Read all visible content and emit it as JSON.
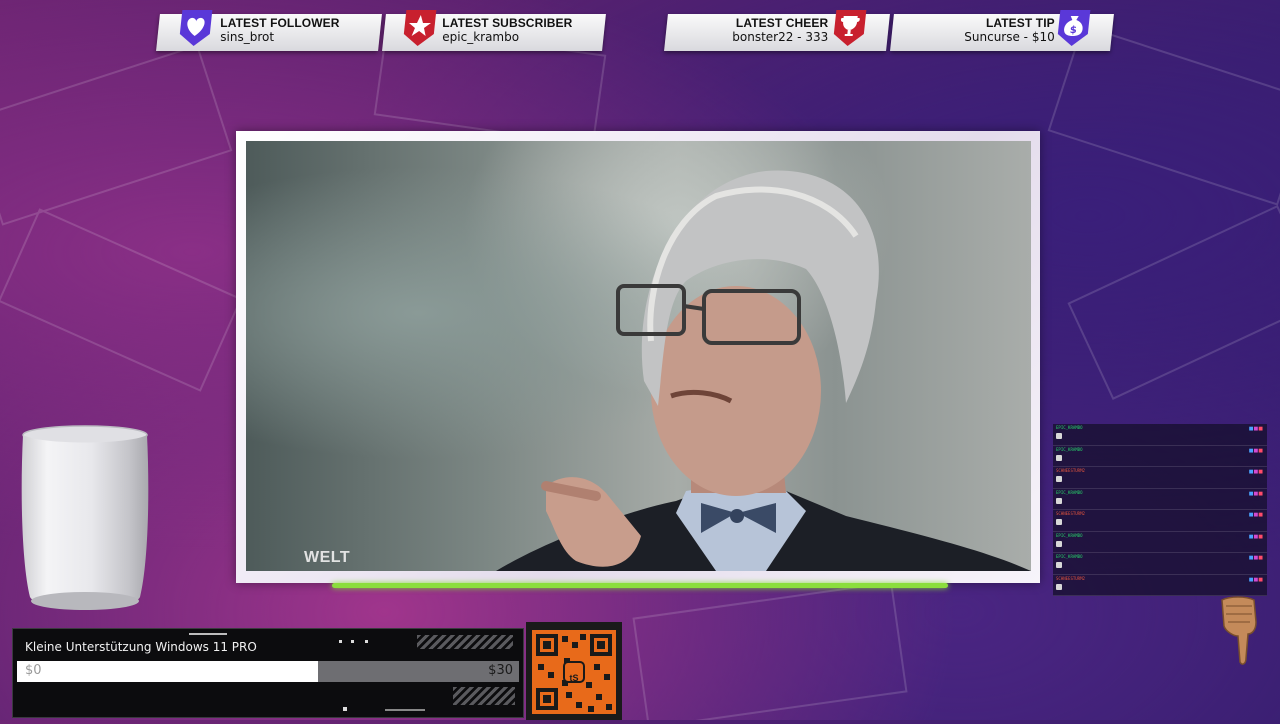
{
  "alerts": [
    {
      "title": "LATEST FOLLOWER",
      "value": "sins_brot",
      "icon": "heart-icon"
    },
    {
      "title": "LATEST SUBSCRIBER",
      "value": "epic_krambo",
      "icon": "star-icon"
    },
    {
      "title": "LATEST CHEER",
      "value": "bonster22 - 333",
      "icon": "trophy-icon"
    },
    {
      "title": "LATEST TIP",
      "value": "Suncurse - $10",
      "icon": "money-bag-icon"
    }
  ],
  "video": {
    "watermark": "WELT"
  },
  "goal": {
    "title": "Kleine Unterstützung Windows 11 PRO",
    "start": "$0",
    "end": "$30",
    "progress": 0.6
  },
  "qr": {
    "logo": "tS"
  },
  "chat": {
    "messages": [
      {
        "user": "EPIC_KRAMBO",
        "color": "#27d36a"
      },
      {
        "user": "EPIC_KRAMBO",
        "color": "#27d36a"
      },
      {
        "user": "SCHNEESTURM2",
        "color": "#e0533e"
      },
      {
        "user": "EPIC_KRAMBO",
        "color": "#27d36a"
      },
      {
        "user": "SCHNEESTURM2",
        "color": "#e0533e"
      },
      {
        "user": "EPIC_KRAMBO",
        "color": "#27d36a"
      },
      {
        "user": "EPIC_KRAMBO",
        "color": "#27d36a"
      },
      {
        "user": "SCHNEESTURM2",
        "color": "#e0533e"
      }
    ]
  },
  "colors": {
    "accent_green": "#8bde3d",
    "follower": "#5a38d8",
    "subscriber": "#c8202e",
    "cheer": "#c8202e",
    "tip": "#5a38d8"
  }
}
